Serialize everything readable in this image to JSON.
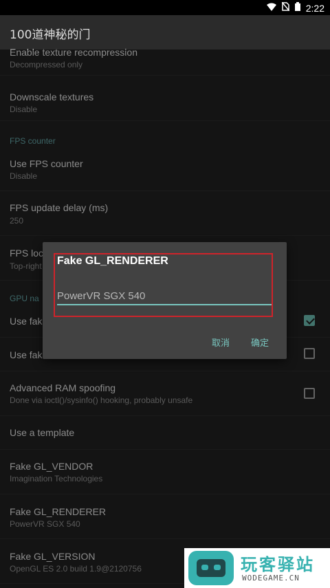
{
  "status": {
    "time": "2:22"
  },
  "app": {
    "title": "100道神秘的门"
  },
  "list": {
    "texture_recompression": {
      "title": "Enable texture recompression",
      "sub": "Decompressed only"
    },
    "downscale": {
      "title": "Downscale textures",
      "sub": "Disable"
    },
    "fps_section": "FPS counter",
    "use_fps": {
      "title": "Use FPS counter",
      "sub": "Disable"
    },
    "fps_delay": {
      "title": "FPS update delay (ms)",
      "sub": "250"
    },
    "fps_loc": {
      "title": "FPS loc",
      "sub": "Top-right"
    },
    "gpu_section": "GPU na",
    "use_fake1": {
      "title": "Use fak",
      "checked": true
    },
    "use_fake2": {
      "title": "Use fak",
      "checked": false
    },
    "ram_spoof": {
      "title": "Advanced RAM spoofing",
      "sub": "Done via ioctl()/sysinfo() hooking, probably unsafe",
      "checked": false
    },
    "template": {
      "title": "Use a template"
    },
    "vendor": {
      "title": "Fake GL_VENDOR",
      "sub": "Imagination Technologies"
    },
    "renderer": {
      "title": "Fake GL_RENDERER",
      "sub": "PowerVR SGX 540"
    },
    "version": {
      "title": "Fake GL_VERSION",
      "sub": "OpenGL ES 2.0 build 1.9@2120756"
    }
  },
  "dialog": {
    "title": "Fake GL_RENDERER",
    "input_value": "PowerVR SGX 540",
    "cancel": "取消",
    "ok": "确定"
  },
  "watermark": {
    "title": "玩客驿站",
    "sub": "WODEGAME.CN"
  },
  "colors": {
    "accent": "#79c7c0",
    "highlight": "#d0232a",
    "section": "#5f9ea0"
  }
}
